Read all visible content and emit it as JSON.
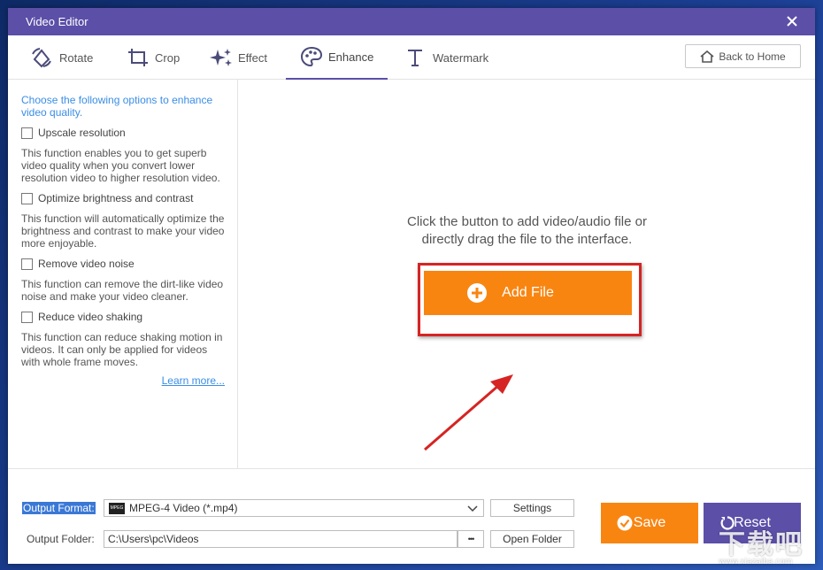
{
  "window": {
    "title": "Video Editor"
  },
  "tabs": [
    {
      "label": "Rotate",
      "icon": "rotate-icon"
    },
    {
      "label": "Crop",
      "icon": "crop-icon"
    },
    {
      "label": "Effect",
      "icon": "sparkle-icon"
    },
    {
      "label": "Enhance",
      "icon": "palette-icon",
      "active": true
    },
    {
      "label": "Watermark",
      "icon": "text-t-icon"
    }
  ],
  "toolbar": {
    "back_home_label": "Back to Home"
  },
  "sidebar": {
    "intro": "Choose the following options to enhance video quality.",
    "options": [
      {
        "label": "Upscale resolution",
        "checked": false,
        "desc": "This function enables you to get superb video quality when you convert lower resolution video to higher resolution video."
      },
      {
        "label": "Optimize brightness and contrast",
        "checked": false,
        "desc": "This function will automatically optimize the brightness and contrast to make your video more enjoyable."
      },
      {
        "label": "Remove video noise",
        "checked": false,
        "desc": "This function can remove the dirt-like video noise and make your video cleaner."
      },
      {
        "label": "Reduce video shaking",
        "checked": false,
        "desc": "This function can reduce shaking motion in videos. It can only be applied for videos with whole frame moves."
      }
    ],
    "learn_more": "Learn more..."
  },
  "main": {
    "hint_line1": "Click the button to add video/audio file or",
    "hint_line2": "directly drag the file to the interface.",
    "add_file_label": "Add File"
  },
  "bottom": {
    "output_format_label": "Output Format:",
    "output_format_value": "MPEG-4 Video (*.mp4)",
    "format_icon_text": "MPEG",
    "settings_label": "Settings",
    "output_folder_label": "Output Folder:",
    "output_folder_value": "C:\\Users\\pc\\Videos",
    "browse_label": "•••",
    "open_folder_label": "Open Folder",
    "save_label": "Save",
    "reset_label": "Reset"
  },
  "watermark": {
    "text": "下载吧",
    "sub": "www.xiazaiba.com"
  },
  "colors": {
    "accent": "#5b4fa8",
    "orange": "#f98511",
    "link": "#3a8ee6",
    "highlight": "#d62424"
  }
}
